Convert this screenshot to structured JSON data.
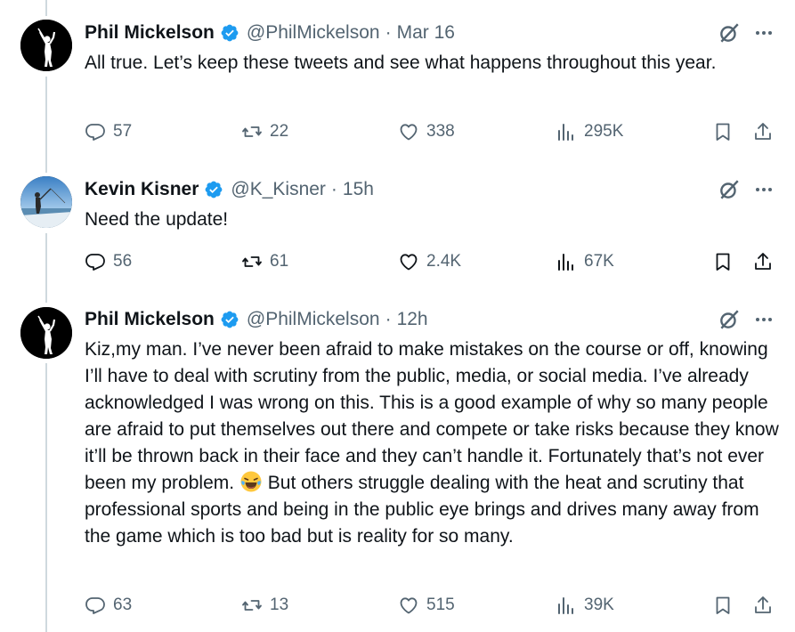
{
  "tweets": [
    {
      "author": "Phil Mickelson",
      "handle": "@PhilMickelson",
      "time": "Mar 16",
      "text": "All true.  Let’s keep these tweets and see what happens throughout this year.",
      "replies": "57",
      "retweets": "22",
      "likes": "338",
      "views": "295K",
      "avatar_icon": "golfer-silhouette-avatar"
    },
    {
      "author": "Kevin Kisner",
      "handle": "@K_Kisner",
      "time": "15h",
      "text": "Need the update!",
      "replies": "56",
      "retweets": "61",
      "likes": "2.4K",
      "views": "67K",
      "avatar_icon": "fishing-photo-avatar"
    },
    {
      "author": "Phil Mickelson",
      "handle": "@PhilMickelson",
      "time": "12h",
      "text_before_emoji": "Kiz,my man. I’ve never been afraid to make mistakes on the course or off, knowing I’ll have to deal with scrutiny from the public, media, or social media. I’ve already acknowledged I was wrong on this. This is a good example of why so many people are afraid to put themselves out there and compete or take risks because they know it’ll be thrown back in their face and they can’t handle it. Fortunately that’s not ever been my problem. ",
      "text_after_emoji": "But others struggle dealing with the heat and scrutiny that professional sports and being in the public eye brings and drives many away from the game which is too bad but is reality for so many.",
      "replies": "63",
      "retweets": "13",
      "likes": "515",
      "views": "39K",
      "avatar_icon": "golfer-silhouette-avatar"
    }
  ],
  "separator": "·",
  "icons": {
    "verified": "verified-badge-icon",
    "grok": "grok-icon",
    "more": "more-options-icon",
    "reply": "reply-icon",
    "retweet": "retweet-icon",
    "like": "heart-icon",
    "views": "views-icon",
    "bookmark": "bookmark-icon",
    "share": "share-icon",
    "emoji": "laughing-tears-emoji"
  },
  "colors": {
    "verified": "#1d9bf0",
    "secondary_text": "#536471",
    "thread_line": "#cfd9de",
    "primary_text": "#0f1419"
  }
}
